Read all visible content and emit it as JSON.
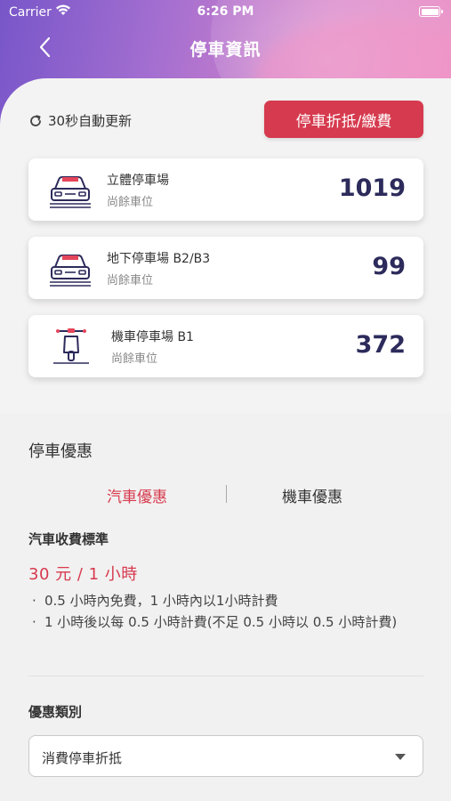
{
  "status_bar": {
    "carrier": "Carrier",
    "time": "6:26 PM"
  },
  "nav": {
    "title": "停車資訊",
    "back_icon": "chevron-left-icon"
  },
  "refresh": {
    "label": "30秒自動更新",
    "icon": "refresh-icon"
  },
  "pay_button": {
    "label": "停車折抵/繳費"
  },
  "lots": [
    {
      "name": "立體停車場",
      "sub": "尚餘車位",
      "count": "1019",
      "icon": "car-icon"
    },
    {
      "name": "地下停車場 B2/B3",
      "sub": "尚餘車位",
      "count": "99",
      "icon": "car-icon"
    },
    {
      "name": "機車停車場 B1",
      "sub": "尚餘車位",
      "count": "372",
      "icon": "scooter-icon"
    }
  ],
  "discount": {
    "title": "停車優惠",
    "tabs": [
      {
        "label": "汽車優惠",
        "active": true
      },
      {
        "label": "機車優惠",
        "active": false
      }
    ],
    "rate_title": "汽車收費標準",
    "rate": "30 元 / 1 小時",
    "rules": [
      "0.5 小時內免費，1 小時內以1小時計費",
      "1 小時後以每 0.5 小時計費(不足 0.5 小時以 0.5 小時計費)"
    ],
    "rule_bullet": "·",
    "type_label": "優惠類別",
    "type_value": "消費停車折抵"
  },
  "colors": {
    "accent": "#d63a4e",
    "count": "#2d2b5b",
    "gradient_start": "#7856c9",
    "gradient_end": "#ec8fc5"
  }
}
